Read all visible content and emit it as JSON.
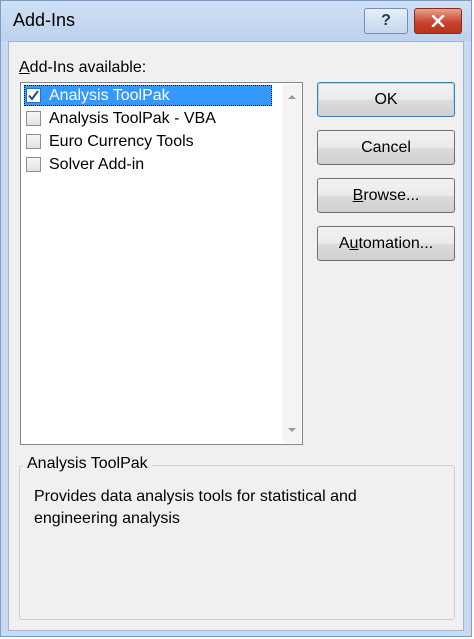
{
  "window": {
    "title": "Add-Ins",
    "help_label": "?"
  },
  "addins": {
    "label_first": "A",
    "label_rest": "dd-Ins available:",
    "items": [
      {
        "label": "Analysis ToolPak",
        "checked": true,
        "selected": true
      },
      {
        "label": "Analysis ToolPak - VBA",
        "checked": false,
        "selected": false
      },
      {
        "label": "Euro Currency Tools",
        "checked": false,
        "selected": false
      },
      {
        "label": "Solver Add-in",
        "checked": false,
        "selected": false
      }
    ]
  },
  "buttons": {
    "ok": "OK",
    "cancel": "Cancel",
    "browse_first": "B",
    "browse_rest": "rowse...",
    "automation_first": "A",
    "automation_u": "u",
    "automation_rest": "tomation..."
  },
  "description": {
    "title": "Analysis ToolPak",
    "text": "Provides data analysis tools for statistical and engineering analysis"
  },
  "colors": {
    "selection": "#3399ff",
    "close_button": "#c9442d"
  }
}
